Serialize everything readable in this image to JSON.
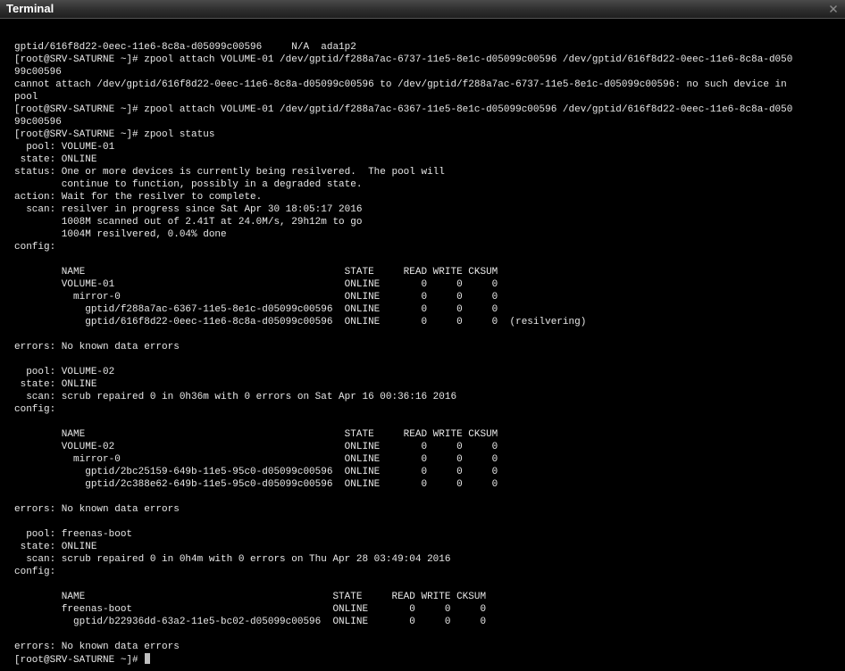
{
  "window": {
    "title": "Terminal",
    "close_icon": "close-icon"
  },
  "terminal": {
    "lines": [
      "gptid/616f8d22-0eec-11e6-8c8a-d05099c00596     N/A  ada1p2",
      "[root@SRV-SATURNE ~]# zpool attach VOLUME-01 /dev/gptid/f288a7ac-6737-11e5-8e1c-d05099c00596 /dev/gptid/616f8d22-0eec-11e6-8c8a-d050",
      "99c00596",
      "cannot attach /dev/gptid/616f8d22-0eec-11e6-8c8a-d05099c00596 to /dev/gptid/f288a7ac-6737-11e5-8e1c-d05099c00596: no such device in",
      "pool",
      "[root@SRV-SATURNE ~]# zpool attach VOLUME-01 /dev/gptid/f288a7ac-6367-11e5-8e1c-d05099c00596 /dev/gptid/616f8d22-0eec-11e6-8c8a-d050",
      "99c00596",
      "[root@SRV-SATURNE ~]# zpool status",
      "  pool: VOLUME-01",
      " state: ONLINE",
      "status: One or more devices is currently being resilvered.  The pool will",
      "        continue to function, possibly in a degraded state.",
      "action: Wait for the resilver to complete.",
      "  scan: resilver in progress since Sat Apr 30 18:05:17 2016",
      "        1008M scanned out of 2.41T at 24.0M/s, 29h12m to go",
      "        1004M resilvered, 0.04% done",
      "config:",
      "",
      "        NAME                                            STATE     READ WRITE CKSUM",
      "        VOLUME-01                                       ONLINE       0     0     0",
      "          mirror-0                                      ONLINE       0     0     0",
      "            gptid/f288a7ac-6367-11e5-8e1c-d05099c00596  ONLINE       0     0     0",
      "            gptid/616f8d22-0eec-11e6-8c8a-d05099c00596  ONLINE       0     0     0  (resilvering)",
      "",
      "errors: No known data errors",
      "",
      "  pool: VOLUME-02",
      " state: ONLINE",
      "  scan: scrub repaired 0 in 0h36m with 0 errors on Sat Apr 16 00:36:16 2016",
      "config:",
      "",
      "        NAME                                            STATE     READ WRITE CKSUM",
      "        VOLUME-02                                       ONLINE       0     0     0",
      "          mirror-0                                      ONLINE       0     0     0",
      "            gptid/2bc25159-649b-11e5-95c0-d05099c00596  ONLINE       0     0     0",
      "            gptid/2c388e62-649b-11e5-95c0-d05099c00596  ONLINE       0     0     0",
      "",
      "errors: No known data errors",
      "",
      "  pool: freenas-boot",
      " state: ONLINE",
      "  scan: scrub repaired 0 in 0h4m with 0 errors on Thu Apr 28 03:49:04 2016",
      "config:",
      "",
      "        NAME                                          STATE     READ WRITE CKSUM",
      "        freenas-boot                                  ONLINE       0     0     0",
      "          gptid/b22936dd-63a2-11e5-bc02-d05099c00596  ONLINE       0     0     0",
      "",
      "errors: No known data errors"
    ],
    "prompt": "[root@SRV-SATURNE ~]# "
  },
  "colors": {
    "background": "#000000",
    "text": "#e8e8e8",
    "titlebar": "#2e2e2e",
    "cursor": "#bfbfbf"
  }
}
